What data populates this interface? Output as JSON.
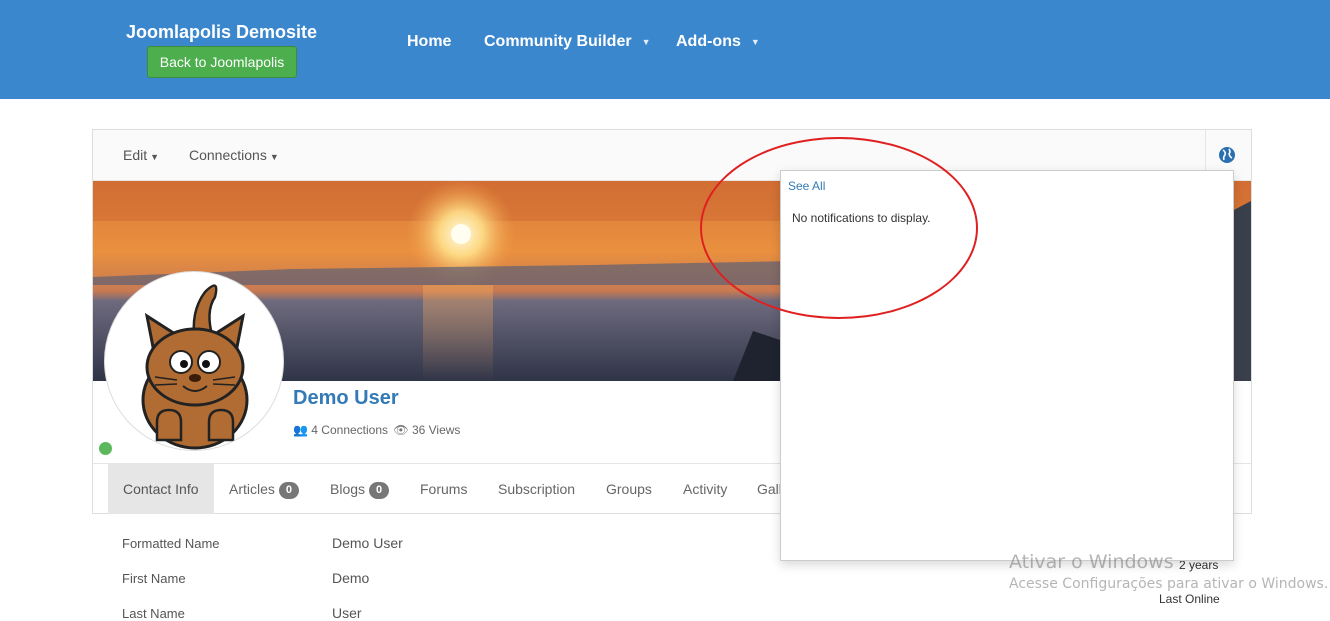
{
  "header": {
    "site_title": "Joomlapolis Demosite",
    "back_button": "Back to Joomlapolis",
    "nav": [
      {
        "label": "Home",
        "has_dropdown": false
      },
      {
        "label": "Community Builder",
        "has_dropdown": true
      },
      {
        "label": "Add-ons",
        "has_dropdown": true
      }
    ]
  },
  "toolbar": {
    "edit_label": "Edit",
    "connections_label": "Connections",
    "notifications_icon": "globe-icon"
  },
  "profile": {
    "name": "Demo User",
    "connections": "4 Connections",
    "views": "36 Views",
    "status_color": "#5cb85c"
  },
  "tabs": [
    {
      "label": "Contact Info",
      "active": true
    },
    {
      "label": "Articles",
      "badge": "0"
    },
    {
      "label": "Blogs",
      "badge": "0"
    },
    {
      "label": "Forums"
    },
    {
      "label": "Subscription"
    },
    {
      "label": "Groups"
    },
    {
      "label": "Activity"
    },
    {
      "label": "Gall"
    }
  ],
  "contact_info": [
    {
      "label": "Formatted Name",
      "value": "Demo User"
    },
    {
      "label": "First Name",
      "value": "Demo"
    },
    {
      "label": "Last Name",
      "value": "User"
    }
  ],
  "notifications": {
    "see_all": "See All",
    "empty_message": "No notifications to display."
  },
  "sidebar_partial": {
    "since": "2 years",
    "last_online_label": "Last Online"
  },
  "watermark": {
    "line1": "Ativar o Windows",
    "line2": "Acesse Configurações para ativar o Windows."
  },
  "colors": {
    "header_bg": "#3a87ce",
    "link": "#337ab7",
    "success": "#4cae4c",
    "annotation": "#e02020"
  }
}
